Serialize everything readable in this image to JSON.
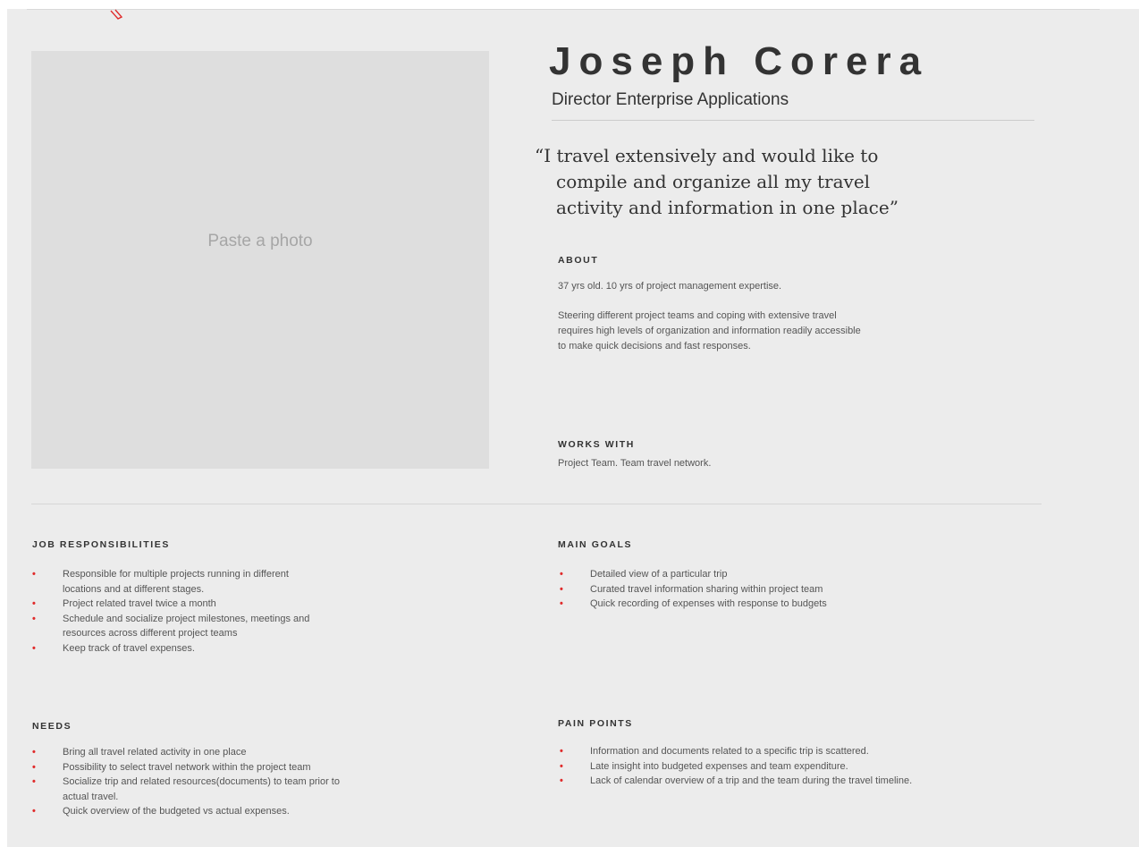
{
  "persona": {
    "name": "Joseph Corera",
    "role": "Director Enterprise Applications"
  },
  "photo": {
    "placeholder": "Paste a photo"
  },
  "quote": {
    "lines": [
      "“I travel extensively and would like to",
      "compile and organize all my travel",
      "activity and information in one place”"
    ]
  },
  "about": {
    "heading": "ABOUT",
    "summary": "37 yrs old. 10 yrs of  project management   expertise.",
    "description_lines": [
      "Steering different project teams and coping with extensive travel",
      "requires high levels of organization and information readily accessible",
      "to make quick decisions and fast responses."
    ]
  },
  "works_with": {
    "heading": "WORKS WITH",
    "text": "Project Team. Team travel network."
  },
  "job_responsibilities": {
    "heading": "JOB RESPONSIBILITIES",
    "items": [
      [
        "Responsible for multiple projects running in different",
        "locations and at different stages."
      ],
      [
        "Project related travel twice a month"
      ],
      [
        "Schedule and socialize project milestones, meetings and",
        "resources across different project teams"
      ],
      [
        "Keep track of travel expenses."
      ]
    ]
  },
  "main_goals": {
    "heading": "MAIN GOALS",
    "items": [
      [
        "Detailed view of a particular trip"
      ],
      [
        "Curated travel information sharing within project team"
      ],
      [
        "Quick recording of expenses with response to budgets"
      ]
    ]
  },
  "needs": {
    "heading": "NEEDS",
    "items": [
      [
        "Bring all travel related activity in one place"
      ],
      [
        "Possibility to select travel network within the project team"
      ],
      [
        "Socialize trip and related resources(documents) to team prior to",
        "actual travel."
      ],
      [
        "Quick overview of the budgeted vs actual expenses."
      ]
    ]
  },
  "pain_points": {
    "heading": "PAIN POINTS",
    "items": [
      [
        "Information and documents related to a specific trip is scattered."
      ],
      [
        "Late insight into budgeted expenses and team expenditure."
      ],
      [
        "Lack of calendar overview of a trip and the team during the travel timeline."
      ]
    ]
  },
  "bullet_char": "•",
  "colors": {
    "background": "#ececec",
    "photo_placeholder": "#dedede",
    "bullet": "#e02b2b",
    "heading_text": "#333333",
    "body_text": "#555555"
  }
}
